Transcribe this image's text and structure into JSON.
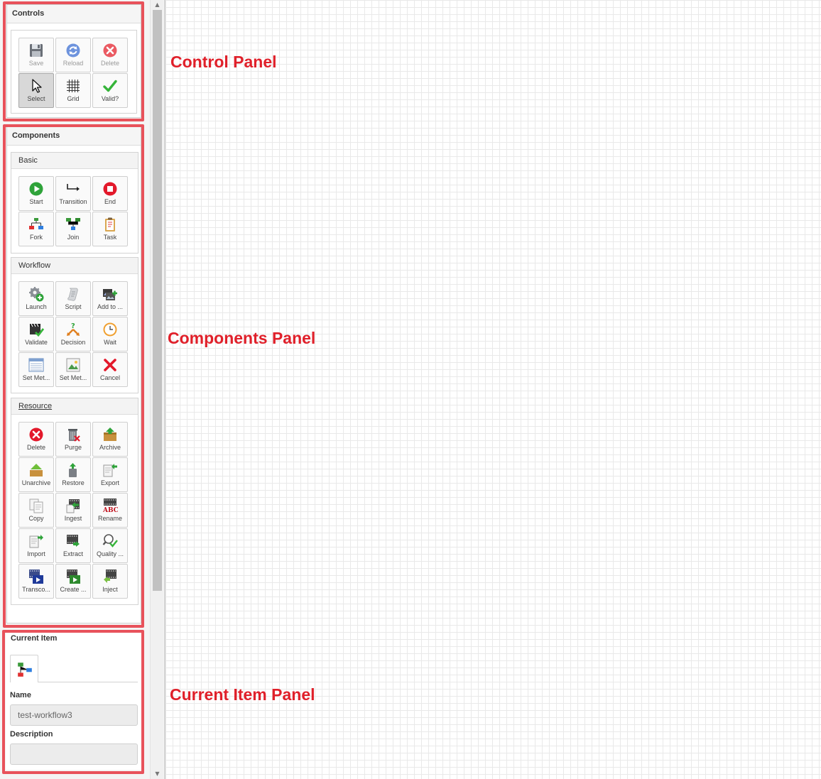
{
  "annotations": {
    "control_panel": "Control Panel",
    "components_panel": "Components Panel",
    "current_item_panel": "Current Item Panel"
  },
  "controls": {
    "title": "Controls",
    "buttons": [
      {
        "label": "Save",
        "icon": "floppy-disk-icon"
      },
      {
        "label": "Reload",
        "icon": "refresh-icon"
      },
      {
        "label": "Delete",
        "icon": "delete-circle-icon"
      },
      {
        "label": "Select",
        "icon": "cursor-arrow-icon"
      },
      {
        "label": "Grid",
        "icon": "grid-icon"
      },
      {
        "label": "Valid?",
        "icon": "check-icon"
      }
    ]
  },
  "components": {
    "title": "Components",
    "groups": [
      {
        "title": "Basic",
        "items": [
          "Start",
          "Transition",
          "End",
          "Fork",
          "Join",
          "Task"
        ]
      },
      {
        "title": "Workflow",
        "items": [
          "Launch",
          "Script",
          "Add to ...",
          "Validate",
          "Decision",
          "Wait",
          "Set Met...",
          "Set Met...",
          "Cancel"
        ]
      },
      {
        "title": "Resource",
        "items": [
          "Delete",
          "Purge",
          "Archive",
          "Unarchive",
          "Restore",
          "Export",
          "Copy",
          "Ingest",
          "Rename",
          "Import",
          "Extract",
          "Quality ...",
          "Transco...",
          "Create ...",
          "Inject"
        ]
      }
    ]
  },
  "current_item": {
    "title": "Current Item",
    "name_label": "Name",
    "name_value": "test-workflow3",
    "description_label": "Description",
    "description_value": ""
  },
  "colors": {
    "highlight": "#e8525b",
    "callout_text": "#e0202a",
    "start_green": "#2fa33a",
    "end_red": "#e3192b",
    "check_green": "#36b43a"
  }
}
